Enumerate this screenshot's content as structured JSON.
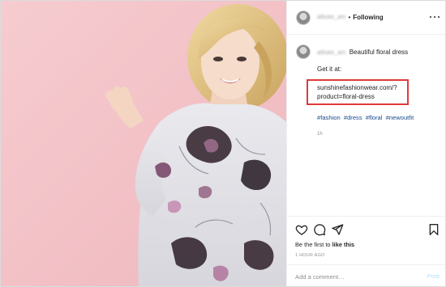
{
  "post": {
    "username_blurred": "allluke_am",
    "separator": "•",
    "follow_status": "Following",
    "caption_title": "Beautiful floral dress",
    "caption_intro": "Get it at:",
    "link_line1": "sunshinefashionwear.com/?",
    "link_line2": "product=floral-dress",
    "hashtags": [
      "#fashion",
      "#dress",
      "#floral",
      "#newoutfit"
    ],
    "age": "1h",
    "likes_prefix": "Be the first to",
    "likes_action": "like this",
    "timestamp": "1 HOUR AGO"
  },
  "comment": {
    "placeholder": "Add a comment…",
    "post_label": "Post"
  },
  "icons": {
    "like": "heart-icon",
    "comment": "comment-icon",
    "share": "paper-plane-icon",
    "save": "bookmark-icon",
    "options": "more-options-icon"
  },
  "colors": {
    "photo_background": "#f3c4c8",
    "highlight_box": "#e03a3a",
    "hashtag": "#1a4b8c",
    "post_button_disabled": "#b2dffc"
  }
}
